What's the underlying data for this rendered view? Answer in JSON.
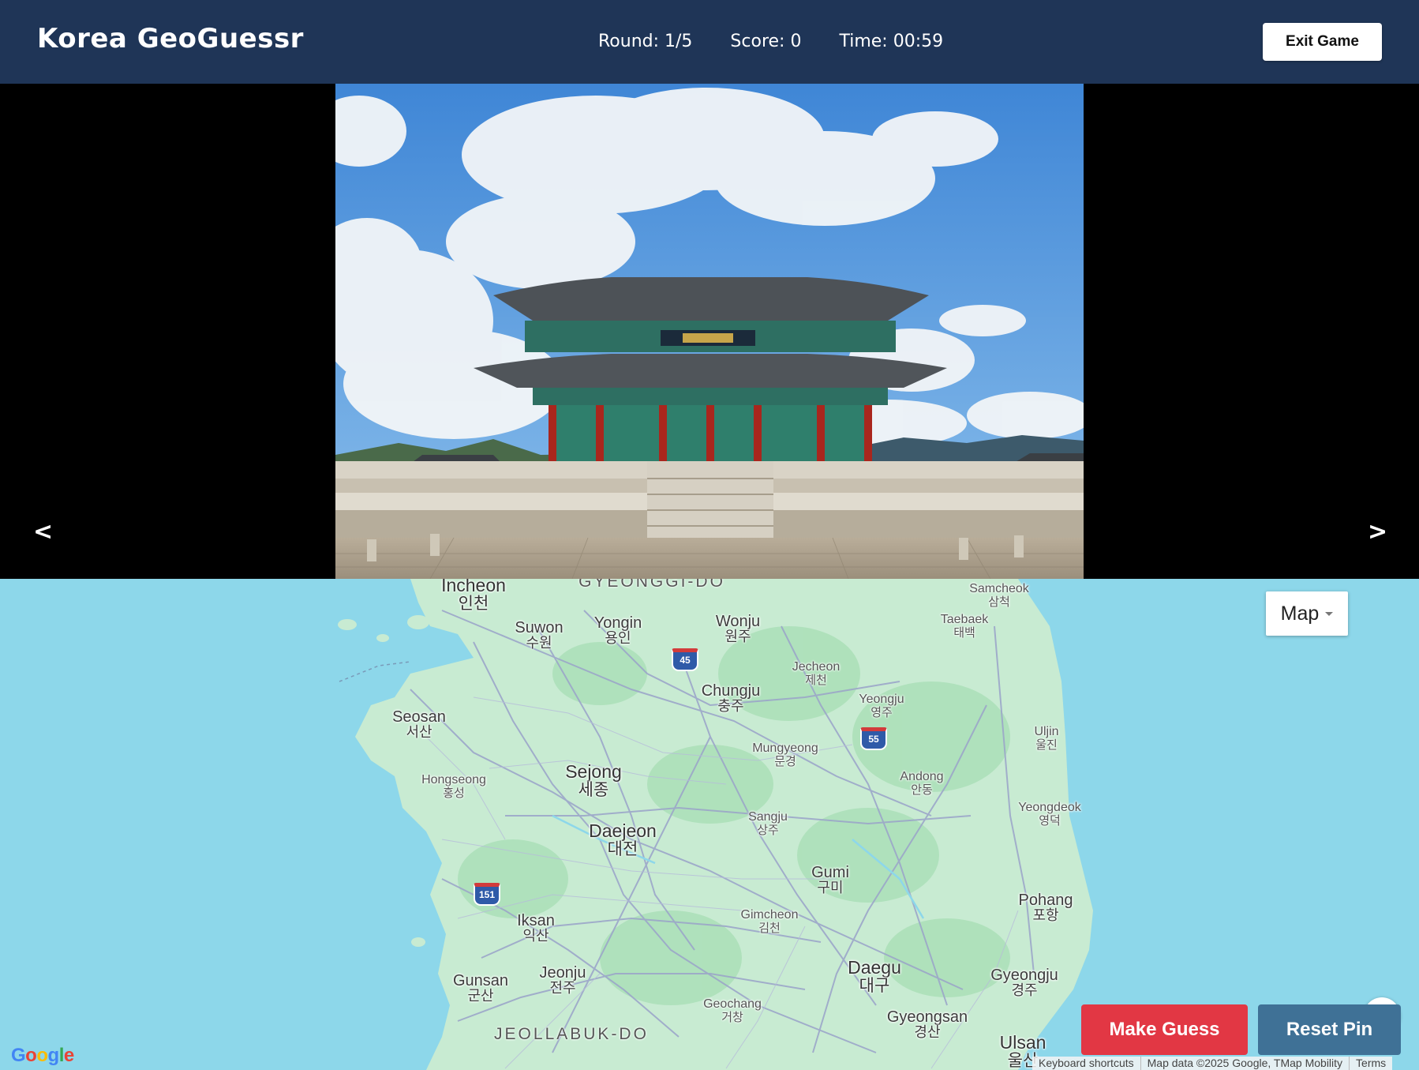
{
  "header": {
    "title": "Korea GeoGuessr",
    "round": "Round: 1/5",
    "score": "Score: 0",
    "time": "Time: 00:59",
    "exit_label": "Exit Game"
  },
  "viewer": {
    "prev_label": "<",
    "next_label": ">",
    "photo_subject": "palace-hall-photo"
  },
  "map": {
    "type_label": "Map",
    "google_logo": "Google",
    "attribution": {
      "shortcuts": "Keyboard shortcuts",
      "data": "Map data ©2025 Google, TMap Mobility",
      "terms": "Terms"
    },
    "regions": [
      "GYEONGGI-DO",
      "JEOLLABUK-DO"
    ],
    "shields": [
      "45",
      "55",
      "151"
    ],
    "cities": {
      "incheon": {
        "en": "Incheon",
        "ko": "인천"
      },
      "suwon": {
        "en": "Suwon",
        "ko": "수원"
      },
      "yongin": {
        "en": "Yongin",
        "ko": "용인"
      },
      "wonju": {
        "en": "Wonju",
        "ko": "원주"
      },
      "samcheok": {
        "en": "Samcheok",
        "ko": "삼척"
      },
      "taebaek": {
        "en": "Taebaek",
        "ko": "태백"
      },
      "jecheon": {
        "en": "Jecheon",
        "ko": "제천"
      },
      "chungju": {
        "en": "Chungju",
        "ko": "충주"
      },
      "yeongju": {
        "en": "Yeongju",
        "ko": "영주"
      },
      "seosan": {
        "en": "Seosan",
        "ko": "서산"
      },
      "uljin": {
        "en": "Uljin",
        "ko": "울진"
      },
      "mungyeong": {
        "en": "Mungyeong",
        "ko": "문경"
      },
      "hongseong": {
        "en": "Hongseong",
        "ko": "홍성"
      },
      "sejong": {
        "en": "Sejong",
        "ko": "세종"
      },
      "andong": {
        "en": "Andong",
        "ko": "안동"
      },
      "yeongdeok": {
        "en": "Yeongdeok",
        "ko": "영덕"
      },
      "sangju": {
        "en": "Sangju",
        "ko": "상주"
      },
      "daejeon": {
        "en": "Daejeon",
        "ko": "대전"
      },
      "gumi": {
        "en": "Gumi",
        "ko": "구미"
      },
      "pohang": {
        "en": "Pohang",
        "ko": "포항"
      },
      "iksan": {
        "en": "Iksan",
        "ko": "익산"
      },
      "gimcheon": {
        "en": "Gimcheon",
        "ko": "김천"
      },
      "daegu": {
        "en": "Daegu",
        "ko": "대구"
      },
      "gyeongju": {
        "en": "Gyeongju",
        "ko": "경주"
      },
      "gunsan": {
        "en": "Gunsan",
        "ko": "군산"
      },
      "jeonju": {
        "en": "Jeonju",
        "ko": "전주"
      },
      "geochang": {
        "en": "Geochang",
        "ko": "거창"
      },
      "gyeongsan": {
        "en": "Gyeongsan",
        "ko": "경산"
      },
      "ulsan": {
        "en": "Ulsan",
        "ko": "울산"
      }
    }
  },
  "actions": {
    "guess_label": "Make Guess",
    "reset_label": "Reset Pin"
  },
  "colors": {
    "header_bg": "#1f3557",
    "guess_btn": "#e23744",
    "reset_btn": "#3f7196",
    "sea": "#8dd7ea",
    "land": "#c8ebd2"
  }
}
